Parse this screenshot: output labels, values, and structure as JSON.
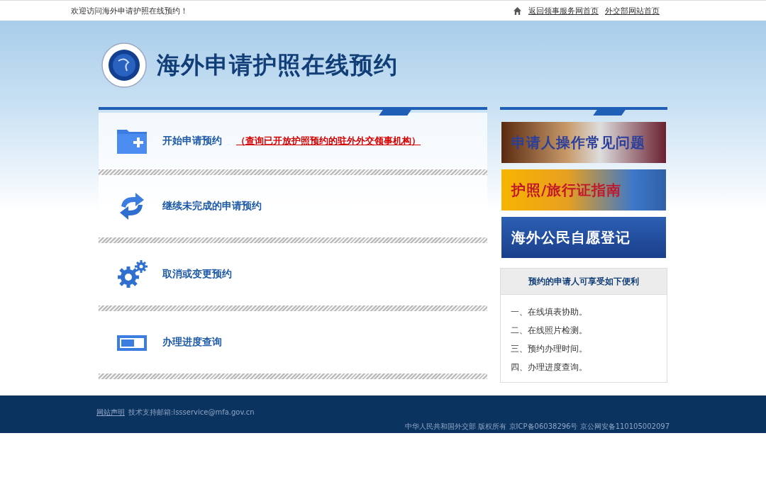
{
  "top_bar": {
    "welcome": "欢迎访问海外申请护照在线预约！",
    "links": [
      "返回领事服务网首页",
      "外交部网站首页"
    ]
  },
  "header": {
    "title": "海外申请护照在线预约"
  },
  "actions": [
    {
      "kind": "new",
      "label": "开始申请预约",
      "note": "（查询已开放护照预约的驻外外交领事机构）"
    },
    {
      "kind": "continue",
      "label": "继续未完成的申请预约"
    },
    {
      "kind": "settings",
      "label": "取消或变更预约"
    },
    {
      "kind": "progress",
      "label": "办理进度查询"
    }
  ],
  "banners": [
    {
      "kind": "faq",
      "text": "申请人操作常见问题"
    },
    {
      "kind": "guide",
      "text": "护照/旅行证指南"
    },
    {
      "kind": "register",
      "text": "海外公民自愿登记"
    }
  ],
  "benefits": {
    "title": "预约的申请人可享受如下便利",
    "items": [
      "一、在线填表协助。",
      "二、在线照片检测。",
      "三、预约办理时间。",
      "四、办理进度查询。"
    ]
  },
  "footer": {
    "statement_link": "网站声明",
    "support": "技术支持邮箱:lssservice@mfa.gov.cn",
    "copyright": "中华人民共和国外交部 版权所有 京ICP备06038296号 京公网安备110105002097"
  }
}
